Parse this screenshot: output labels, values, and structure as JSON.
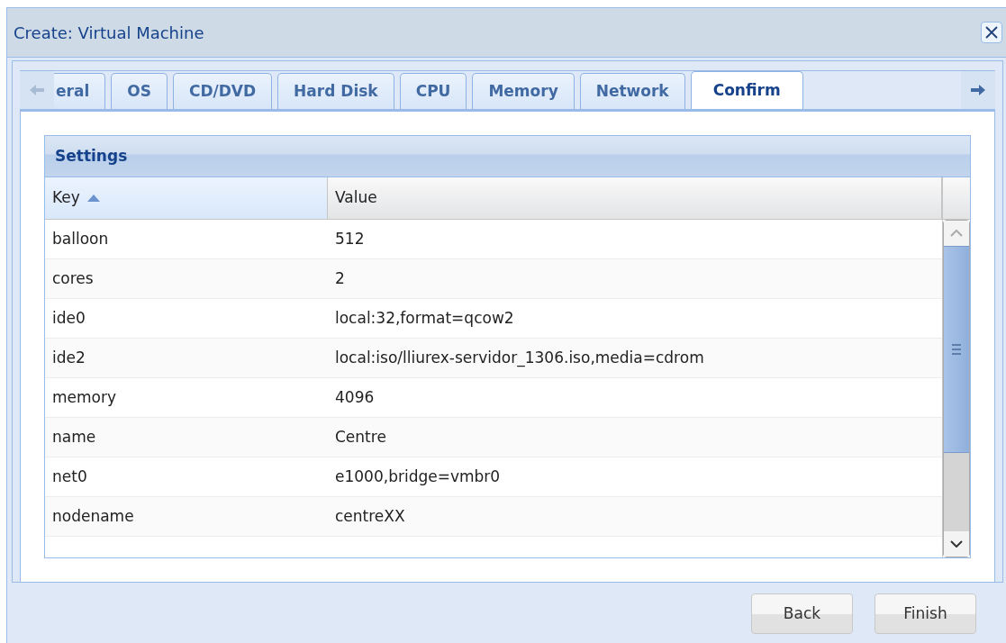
{
  "window": {
    "title": "Create: Virtual Machine"
  },
  "tab_scroll": {
    "left_disabled": true,
    "right_disabled": false
  },
  "tabs": [
    {
      "label": "eral",
      "selected": false
    },
    {
      "label": "OS",
      "selected": false
    },
    {
      "label": "CD/DVD",
      "selected": false
    },
    {
      "label": "Hard Disk",
      "selected": false
    },
    {
      "label": "CPU",
      "selected": false
    },
    {
      "label": "Memory",
      "selected": false
    },
    {
      "label": "Network",
      "selected": false
    },
    {
      "label": "Confirm",
      "selected": true
    }
  ],
  "panel": {
    "title": "Settings"
  },
  "table": {
    "columns": [
      {
        "label": "Key",
        "sorted": true
      },
      {
        "label": "Value",
        "sorted": false
      }
    ],
    "rows": [
      [
        "balloon",
        "512"
      ],
      [
        "cores",
        "2"
      ],
      [
        "ide0",
        "local:32,format=qcow2"
      ],
      [
        "ide2",
        "local:iso/lliurex-servidor_1306.iso,media=cdrom"
      ],
      [
        "memory",
        "4096"
      ],
      [
        "name",
        "Centre"
      ],
      [
        "net0",
        "e1000,bridge=vmbr0"
      ],
      [
        "nodename",
        "centreXX"
      ]
    ]
  },
  "buttons": [
    {
      "label": "Back"
    },
    {
      "label": "Finish"
    }
  ]
}
